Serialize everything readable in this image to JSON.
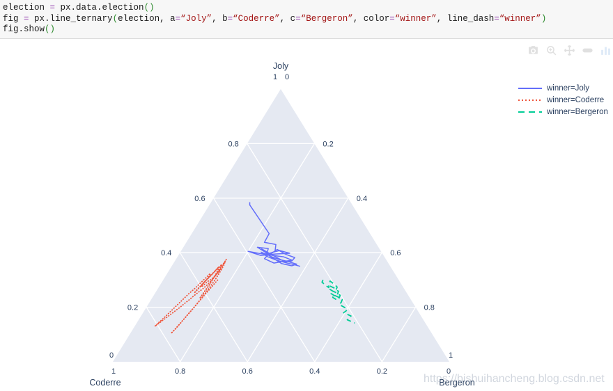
{
  "code": {
    "lines": [
      [
        {
          "t": "election ",
          "c": "plain"
        },
        {
          "t": "=",
          "c": "op"
        },
        {
          "t": " px.data.election",
          "c": "plain"
        },
        {
          "t": "()",
          "c": "paren"
        }
      ],
      [
        {
          "t": "fig ",
          "c": "plain"
        },
        {
          "t": "=",
          "c": "op"
        },
        {
          "t": " px.line_ternary",
          "c": "plain"
        },
        {
          "t": "(",
          "c": "paren"
        },
        {
          "t": "election, a",
          "c": "plain"
        },
        {
          "t": "=",
          "c": "op"
        },
        {
          "t": "“Joly”",
          "c": "str"
        },
        {
          "t": ", b",
          "c": "plain"
        },
        {
          "t": "=",
          "c": "op"
        },
        {
          "t": "“Coderre”",
          "c": "str"
        },
        {
          "t": ", c",
          "c": "plain"
        },
        {
          "t": "=",
          "c": "op"
        },
        {
          "t": "“Bergeron”",
          "c": "str"
        },
        {
          "t": ", color",
          "c": "plain"
        },
        {
          "t": "=",
          "c": "op"
        },
        {
          "t": "“winner”",
          "c": "str"
        },
        {
          "t": ", line_dash",
          "c": "plain"
        },
        {
          "t": "=",
          "c": "op"
        },
        {
          "t": "“winner”",
          "c": "str"
        },
        {
          "t": ")",
          "c": "paren"
        }
      ],
      [
        {
          "t": "fig.show",
          "c": "plain"
        },
        {
          "t": "()",
          "c": "paren"
        }
      ]
    ]
  },
  "modebar": {
    "buttons": [
      {
        "name": "download-plot-icon",
        "title": "Download plot as a png"
      },
      {
        "name": "zoom-icon",
        "title": "Zoom"
      },
      {
        "name": "pan-icon",
        "title": "Pan"
      },
      {
        "name": "reset-view-icon",
        "title": "Reset view"
      },
      {
        "name": "plotly-logo-icon",
        "title": "Produced with Plotly"
      }
    ]
  },
  "legend": {
    "items": [
      {
        "label": "winner=Joly",
        "color": "#636efa",
        "dash": "solid"
      },
      {
        "label": "winner=Coderre",
        "color": "#ef553b",
        "dash": "dot"
      },
      {
        "label": "winner=Bergeron",
        "color": "#00cc96",
        "dash": "dash"
      }
    ]
  },
  "watermark": {
    "text": "https://bishuihancheng.blog.csdn.net"
  },
  "chart_data": {
    "type": "line",
    "subtype": "ternary",
    "title": "",
    "plot_bgcolor": "#e5e9f2",
    "gridcolor": "#ffffff",
    "paper_bgcolor": "#ffffff",
    "axes": {
      "a": {
        "title": "Joly",
        "position": "top",
        "corner_label": "1",
        "ticks": [
          "0.2",
          "0.4",
          "0.6",
          "0.8"
        ],
        "tick_values": [
          0.2,
          0.4,
          0.6,
          0.8
        ],
        "range": [
          0,
          1
        ]
      },
      "b": {
        "title": "Coderre",
        "position": "bottom-left",
        "corner_label": "1",
        "ticks": [
          "0.2",
          "0.4",
          "0.6",
          "0.8"
        ],
        "tick_values": [
          0.2,
          0.4,
          0.6,
          0.8
        ],
        "range": [
          0,
          1
        ]
      },
      "c": {
        "title": "Bergeron",
        "position": "bottom-right",
        "corner_label": "1",
        "ticks": [
          "0.2",
          "0.4",
          "0.6",
          "0.8"
        ],
        "tick_values": [
          0.2,
          0.4,
          0.6,
          0.8
        ],
        "range": [
          0,
          1
        ]
      }
    },
    "corner_zeros": {
      "top_left": "1",
      "top_right": "0",
      "bottom_left_upper": "0",
      "bottom_left_lower": "1",
      "bottom_right_upper": "1",
      "bottom_right_lower": "0"
    },
    "legend_position": "right",
    "legend_title": "winner, winner",
    "series": [
      {
        "name": "winner=Joly",
        "color": "#636efa",
        "dash": "solid",
        "points_abc": [
          [
            0.585,
            0.3,
            0.115
          ],
          [
            0.575,
            0.305,
            0.12
          ],
          [
            0.47,
            0.3,
            0.23
          ],
          [
            0.438,
            0.33,
            0.232
          ],
          [
            0.43,
            0.3,
            0.27
          ],
          [
            0.405,
            0.315,
            0.28
          ],
          [
            0.395,
            0.34,
            0.265
          ],
          [
            0.42,
            0.36,
            0.22
          ],
          [
            0.415,
            0.33,
            0.255
          ],
          [
            0.395,
            0.345,
            0.26
          ],
          [
            0.408,
            0.3,
            0.292
          ],
          [
            0.398,
            0.275,
            0.327
          ],
          [
            0.395,
            0.32,
            0.285
          ],
          [
            0.39,
            0.365,
            0.245
          ],
          [
            0.405,
            0.395,
            0.2
          ],
          [
            0.398,
            0.368,
            0.234
          ],
          [
            0.392,
            0.34,
            0.268
          ],
          [
            0.385,
            0.3,
            0.315
          ],
          [
            0.372,
            0.28,
            0.348
          ],
          [
            0.368,
            0.31,
            0.322
          ],
          [
            0.362,
            0.34,
            0.298
          ],
          [
            0.378,
            0.36,
            0.262
          ],
          [
            0.39,
            0.345,
            0.265
          ],
          [
            0.4,
            0.325,
            0.275
          ],
          [
            0.412,
            0.305,
            0.283
          ],
          [
            0.395,
            0.29,
            0.315
          ],
          [
            0.382,
            0.268,
            0.35
          ],
          [
            0.37,
            0.282,
            0.348
          ],
          [
            0.366,
            0.305,
            0.329
          ],
          [
            0.4,
            0.338,
            0.262
          ],
          [
            0.414,
            0.35,
            0.236
          ],
          [
            0.388,
            0.34,
            0.272
          ],
          [
            0.376,
            0.32,
            0.304
          ],
          [
            0.368,
            0.296,
            0.336
          ],
          [
            0.358,
            0.274,
            0.368
          ],
          [
            0.352,
            0.292,
            0.356
          ],
          [
            0.36,
            0.318,
            0.322
          ],
          [
            0.392,
            0.342,
            0.266
          ],
          [
            0.402,
            0.358,
            0.24
          ],
          [
            0.386,
            0.348,
            0.266
          ],
          [
            0.372,
            0.326,
            0.302
          ],
          [
            0.362,
            0.3,
            0.338
          ],
          [
            0.356,
            0.282,
            0.362
          ],
          [
            0.35,
            0.268,
            0.382
          ]
        ]
      },
      {
        "name": "winner=Coderre",
        "color": "#ef553b",
        "dash": "dot",
        "points_abc": [
          [
            0.375,
            0.475,
            0.15
          ],
          [
            0.355,
            0.495,
            0.15
          ],
          [
            0.33,
            0.52,
            0.15
          ],
          [
            0.31,
            0.545,
            0.145
          ],
          [
            0.3,
            0.56,
            0.14
          ],
          [
            0.295,
            0.57,
            0.135
          ],
          [
            0.288,
            0.58,
            0.132
          ],
          [
            0.28,
            0.59,
            0.13
          ],
          [
            0.275,
            0.6,
            0.125
          ],
          [
            0.29,
            0.585,
            0.125
          ],
          [
            0.305,
            0.565,
            0.13
          ],
          [
            0.32,
            0.545,
            0.135
          ],
          [
            0.34,
            0.52,
            0.14
          ],
          [
            0.355,
            0.5,
            0.145
          ],
          [
            0.34,
            0.51,
            0.15
          ],
          [
            0.32,
            0.532,
            0.148
          ],
          [
            0.3,
            0.555,
            0.145
          ],
          [
            0.282,
            0.578,
            0.14
          ],
          [
            0.268,
            0.598,
            0.134
          ],
          [
            0.255,
            0.618,
            0.127
          ],
          [
            0.242,
            0.638,
            0.12
          ],
          [
            0.228,
            0.658,
            0.114
          ],
          [
            0.215,
            0.678,
            0.107
          ],
          [
            0.2,
            0.7,
            0.1
          ],
          [
            0.186,
            0.722,
            0.092
          ],
          [
            0.172,
            0.744,
            0.084
          ],
          [
            0.158,
            0.766,
            0.076
          ],
          [
            0.144,
            0.788,
            0.068
          ],
          [
            0.13,
            0.81,
            0.06
          ],
          [
            0.145,
            0.79,
            0.065
          ],
          [
            0.162,
            0.766,
            0.072
          ],
          [
            0.18,
            0.742,
            0.078
          ],
          [
            0.198,
            0.718,
            0.084
          ],
          [
            0.216,
            0.694,
            0.09
          ],
          [
            0.234,
            0.67,
            0.096
          ],
          [
            0.252,
            0.646,
            0.102
          ],
          [
            0.27,
            0.62,
            0.11
          ],
          [
            0.288,
            0.596,
            0.116
          ],
          [
            0.306,
            0.572,
            0.122
          ],
          [
            0.324,
            0.548,
            0.128
          ],
          [
            0.31,
            0.56,
            0.13
          ],
          [
            0.295,
            0.578,
            0.127
          ],
          [
            0.28,
            0.596,
            0.124
          ],
          [
            0.266,
            0.614,
            0.12
          ],
          [
            0.252,
            0.632,
            0.116
          ],
          [
            0.264,
            0.618,
            0.118
          ],
          [
            0.282,
            0.595,
            0.123
          ],
          [
            0.3,
            0.572,
            0.128
          ],
          [
            0.318,
            0.549,
            0.133
          ],
          [
            0.336,
            0.526,
            0.138
          ],
          [
            0.35,
            0.508,
            0.142
          ],
          [
            0.335,
            0.52,
            0.145
          ],
          [
            0.318,
            0.536,
            0.146
          ],
          [
            0.3,
            0.554,
            0.146
          ],
          [
            0.282,
            0.572,
            0.146
          ],
          [
            0.265,
            0.59,
            0.145
          ],
          [
            0.248,
            0.608,
            0.144
          ],
          [
            0.232,
            0.626,
            0.142
          ],
          [
            0.245,
            0.612,
            0.143
          ],
          [
            0.262,
            0.594,
            0.144
          ],
          [
            0.28,
            0.574,
            0.146
          ],
          [
            0.298,
            0.556,
            0.146
          ],
          [
            0.316,
            0.538,
            0.146
          ],
          [
            0.334,
            0.52,
            0.146
          ],
          [
            0.352,
            0.5,
            0.148
          ],
          [
            0.37,
            0.48,
            0.15
          ],
          [
            0.355,
            0.492,
            0.153
          ],
          [
            0.338,
            0.508,
            0.154
          ],
          [
            0.32,
            0.526,
            0.154
          ],
          [
            0.3,
            0.546,
            0.154
          ],
          [
            0.28,
            0.568,
            0.152
          ],
          [
            0.26,
            0.59,
            0.15
          ],
          [
            0.24,
            0.612,
            0.148
          ],
          [
            0.22,
            0.635,
            0.145
          ],
          [
            0.2,
            0.658,
            0.142
          ],
          [
            0.18,
            0.682,
            0.138
          ],
          [
            0.16,
            0.706,
            0.134
          ],
          [
            0.14,
            0.73,
            0.13
          ],
          [
            0.12,
            0.754,
            0.126
          ],
          [
            0.104,
            0.775,
            0.121
          ],
          [
            0.122,
            0.752,
            0.126
          ],
          [
            0.142,
            0.728,
            0.13
          ],
          [
            0.162,
            0.704,
            0.134
          ],
          [
            0.182,
            0.68,
            0.138
          ],
          [
            0.202,
            0.656,
            0.142
          ],
          [
            0.222,
            0.632,
            0.146
          ],
          [
            0.242,
            0.608,
            0.15
          ],
          [
            0.262,
            0.584,
            0.154
          ],
          [
            0.282,
            0.56,
            0.158
          ],
          [
            0.3,
            0.538,
            0.162
          ]
        ]
      },
      {
        "name": "winner=Bergeron",
        "color": "#00cc96",
        "dash": "dash",
        "points_abc": [
          [
            0.3,
            0.225,
            0.475
          ],
          [
            0.292,
            0.232,
            0.476
          ],
          [
            0.282,
            0.228,
            0.49
          ],
          [
            0.272,
            0.222,
            0.506
          ],
          [
            0.285,
            0.215,
            0.5
          ],
          [
            0.296,
            0.206,
            0.498
          ],
          [
            0.286,
            0.2,
            0.514
          ],
          [
            0.274,
            0.196,
            0.53
          ],
          [
            0.264,
            0.204,
            0.532
          ],
          [
            0.256,
            0.214,
            0.53
          ],
          [
            0.266,
            0.222,
            0.512
          ],
          [
            0.278,
            0.216,
            0.506
          ],
          [
            0.27,
            0.206,
            0.524
          ],
          [
            0.258,
            0.2,
            0.542
          ],
          [
            0.248,
            0.208,
            0.544
          ],
          [
            0.24,
            0.218,
            0.542
          ],
          [
            0.25,
            0.226,
            0.524
          ],
          [
            0.262,
            0.22,
            0.518
          ],
          [
            0.254,
            0.21,
            0.536
          ],
          [
            0.244,
            0.202,
            0.554
          ],
          [
            0.234,
            0.21,
            0.556
          ],
          [
            0.226,
            0.22,
            0.554
          ],
          [
            0.236,
            0.228,
            0.536
          ],
          [
            0.246,
            0.222,
            0.532
          ],
          [
            0.238,
            0.212,
            0.55
          ],
          [
            0.228,
            0.204,
            0.568
          ],
          [
            0.218,
            0.212,
            0.57
          ],
          [
            0.21,
            0.222,
            0.568
          ],
          [
            0.202,
            0.214,
            0.584
          ],
          [
            0.194,
            0.206,
            0.6
          ],
          [
            0.186,
            0.214,
            0.6
          ],
          [
            0.18,
            0.224,
            0.596
          ],
          [
            0.174,
            0.216,
            0.61
          ],
          [
            0.168,
            0.208,
            0.624
          ],
          [
            0.16,
            0.216,
            0.624
          ],
          [
            0.154,
            0.226,
            0.62
          ],
          [
            0.148,
            0.218,
            0.634
          ],
          [
            0.142,
            0.21,
            0.648
          ]
        ]
      }
    ]
  }
}
